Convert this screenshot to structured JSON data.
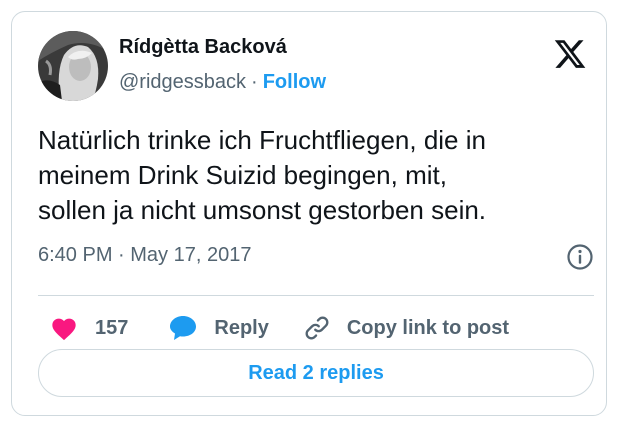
{
  "author": {
    "name": "Rídgètta Backová",
    "handle": "@ridgessback",
    "separator": "·",
    "follow_label": "Follow"
  },
  "tweet": {
    "text_lines": [
      "Natürlich trinke ich Fruchtfliegen, die in",
      "meinem Drink Suizid begingen, mit,",
      "sollen ja nicht umsonst gestorben sein."
    ],
    "timestamp": "6:40 PM · May 17, 2017"
  },
  "actions": {
    "like_count": "157",
    "reply_label": "Reply",
    "copy_label": "Copy link to post"
  },
  "read_replies_label": "Read 2 replies",
  "icons": {
    "logo": "x-logo-icon",
    "info": "info-icon",
    "like": "heart-icon",
    "reply": "speech-bubble-icon",
    "copy": "link-icon"
  },
  "colors": {
    "accent": "#1d9bf0",
    "like": "#f91880",
    "text_primary": "#0f1419",
    "text_secondary": "#536471",
    "border": "#cfd9de"
  }
}
